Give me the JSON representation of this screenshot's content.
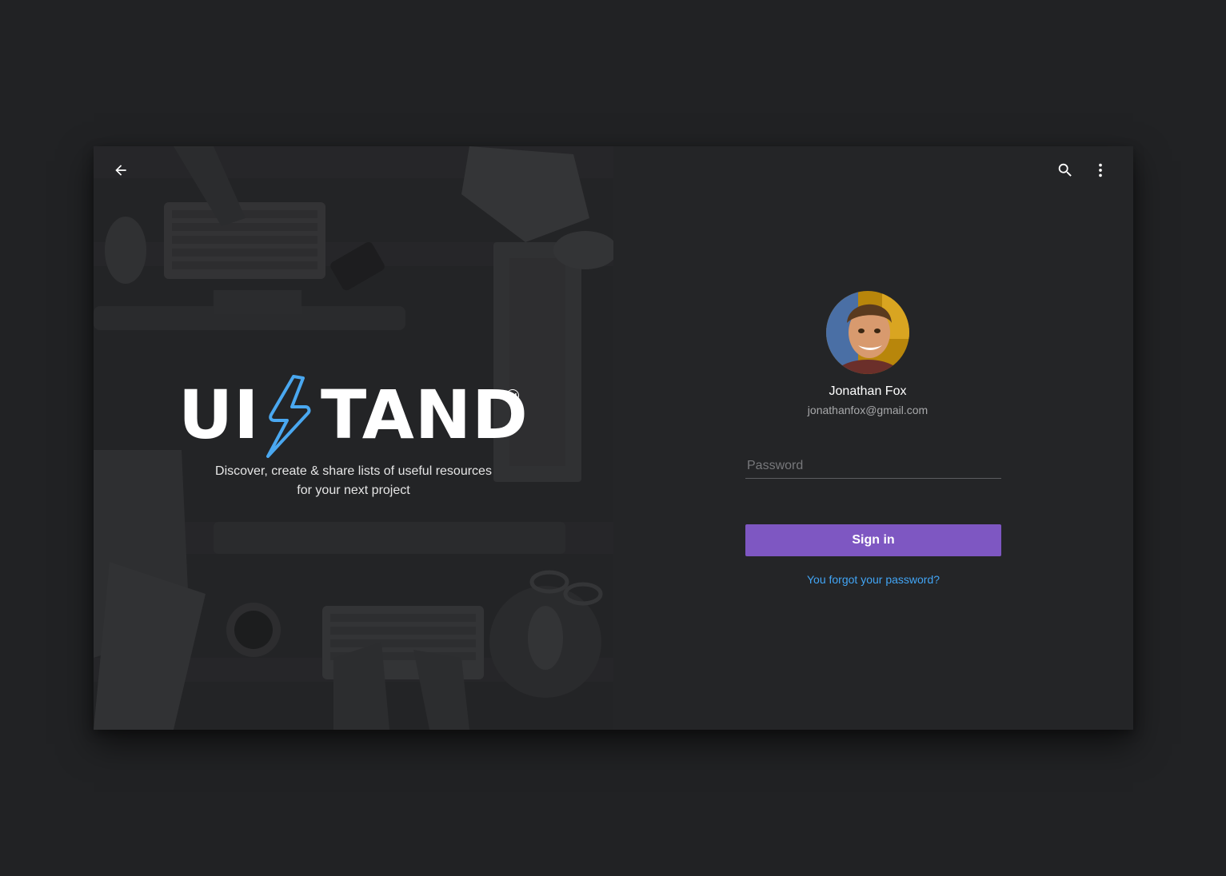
{
  "colors": {
    "page_bg": "#212224",
    "panel_bg": "#242527",
    "accent_purple": "#7e57c2",
    "link_blue": "#42a5f5",
    "bolt_blue": "#4aa8f0"
  },
  "icons": {
    "back": "arrow-left-icon",
    "search": "search-icon",
    "menu": "more-vert-icon"
  },
  "hero": {
    "logo_left": "UI",
    "logo_right": "TAND",
    "trademark": "TM",
    "tagline_line1": "Discover, create & share lists of useful resources",
    "tagline_line2": "for your next project"
  },
  "user": {
    "name": "Jonathan Fox",
    "email": "jonathanfox@gmail.com"
  },
  "form": {
    "password_placeholder": "Password",
    "password_value": "",
    "signin_label": "Sign in",
    "forgot_label": "You forgot your password?"
  }
}
